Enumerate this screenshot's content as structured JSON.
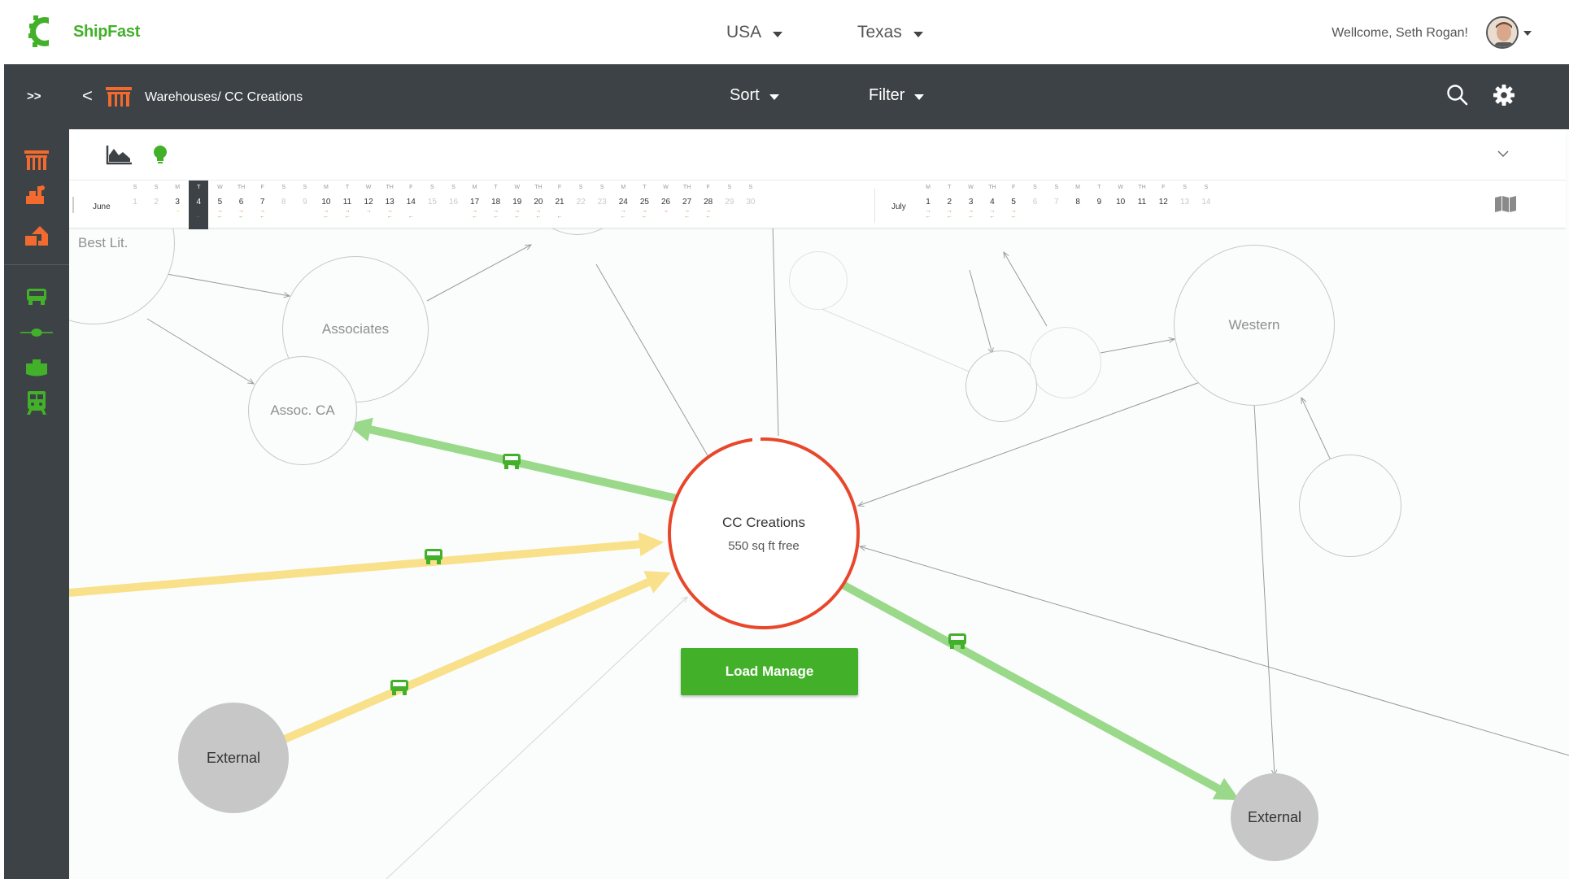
{
  "header": {
    "brand": "ShipFast",
    "country": "USA",
    "state": "Texas",
    "welcome": "Wellcome, Seth Rogan!"
  },
  "toolbar": {
    "expand_label": ">>",
    "back_label": "<",
    "breadcrumb": "Warehouses/ CC Creations",
    "sort_label": "Sort",
    "filter_label": "Filter"
  },
  "sidebar": {
    "items": [
      "warehouse-icon",
      "factory-icon",
      "distribution-icon",
      "truck-icon",
      "plane-icon",
      "ship-icon",
      "train-icon"
    ]
  },
  "calendar": {
    "months": [
      "June",
      "July"
    ],
    "june": [
      {
        "d": "S",
        "n": "1",
        "f": true
      },
      {
        "d": "S",
        "n": "2",
        "f": true
      },
      {
        "d": "M",
        "n": "3",
        "y": true
      },
      {
        "d": "T",
        "n": "4",
        "sel": true,
        "g": true
      },
      {
        "d": "W",
        "n": "5",
        "r": true,
        "g": true
      },
      {
        "d": "TH",
        "n": "6",
        "r": true,
        "g": true
      },
      {
        "d": "F",
        "n": "7",
        "r": true,
        "g": true
      },
      {
        "d": "S",
        "n": "8",
        "f": true
      },
      {
        "d": "S",
        "n": "9",
        "f": true
      },
      {
        "d": "M",
        "n": "10",
        "r": true,
        "g": true
      },
      {
        "d": "T",
        "n": "11",
        "r": true,
        "g": true
      },
      {
        "d": "W",
        "n": "12",
        "r": true
      },
      {
        "d": "TH",
        "n": "13",
        "r": true,
        "g": true
      },
      {
        "d": "F",
        "n": "14",
        "g": true
      },
      {
        "d": "S",
        "n": "15",
        "f": true
      },
      {
        "d": "S",
        "n": "16",
        "f": true
      },
      {
        "d": "M",
        "n": "17",
        "r": true,
        "g": true
      },
      {
        "d": "T",
        "n": "18",
        "r": true,
        "g": true
      },
      {
        "d": "W",
        "n": "19",
        "r": true,
        "g": true
      },
      {
        "d": "TH",
        "n": "20",
        "r": true,
        "g": true
      },
      {
        "d": "F",
        "n": "21",
        "g": true
      },
      {
        "d": "S",
        "n": "22",
        "f": true
      },
      {
        "d": "S",
        "n": "23",
        "f": true
      },
      {
        "d": "M",
        "n": "24",
        "r": true,
        "g": true
      },
      {
        "d": "T",
        "n": "25",
        "r": true,
        "g": true
      },
      {
        "d": "W",
        "n": "26",
        "r": true
      },
      {
        "d": "TH",
        "n": "27",
        "r": true,
        "g": true
      },
      {
        "d": "F",
        "n": "28",
        "r": true,
        "g": true
      },
      {
        "d": "S",
        "n": "29",
        "f": true
      },
      {
        "d": "S",
        "n": "30",
        "f": true
      }
    ],
    "july": [
      {
        "d": "M",
        "n": "1",
        "r": true,
        "g": true
      },
      {
        "d": "T",
        "n": "2",
        "r": true,
        "g": true
      },
      {
        "d": "W",
        "n": "3",
        "r": true,
        "g": true
      },
      {
        "d": "TH",
        "n": "4",
        "r": true,
        "g": true
      },
      {
        "d": "F",
        "n": "5",
        "r": true,
        "g": true
      },
      {
        "d": "S",
        "n": "6",
        "f": true
      },
      {
        "d": "S",
        "n": "7",
        "f": true
      },
      {
        "d": "M",
        "n": "8"
      },
      {
        "d": "T",
        "n": "9"
      },
      {
        "d": "W",
        "n": "10"
      },
      {
        "d": "TH",
        "n": "11"
      },
      {
        "d": "F",
        "n": "12"
      },
      {
        "d": "S",
        "n": "13",
        "f": true
      },
      {
        "d": "S",
        "n": "14",
        "f": true
      }
    ]
  },
  "nodes": {
    "best_lit": "Best Lit.",
    "associates": "Associates",
    "assoc_ca": "Assoc. CA",
    "western": "Western",
    "external_left": "External",
    "external_right": "External",
    "focus_title": "CC Creations",
    "focus_sub": "550 sq ft free"
  },
  "actions": {
    "load_manage": "Load Manage"
  },
  "colors": {
    "brand_green": "#43b02a",
    "accent_orange": "#e8472b",
    "route_green": "#9ad98a",
    "route_yellow": "#f8e18a",
    "dark": "#3c4246"
  }
}
